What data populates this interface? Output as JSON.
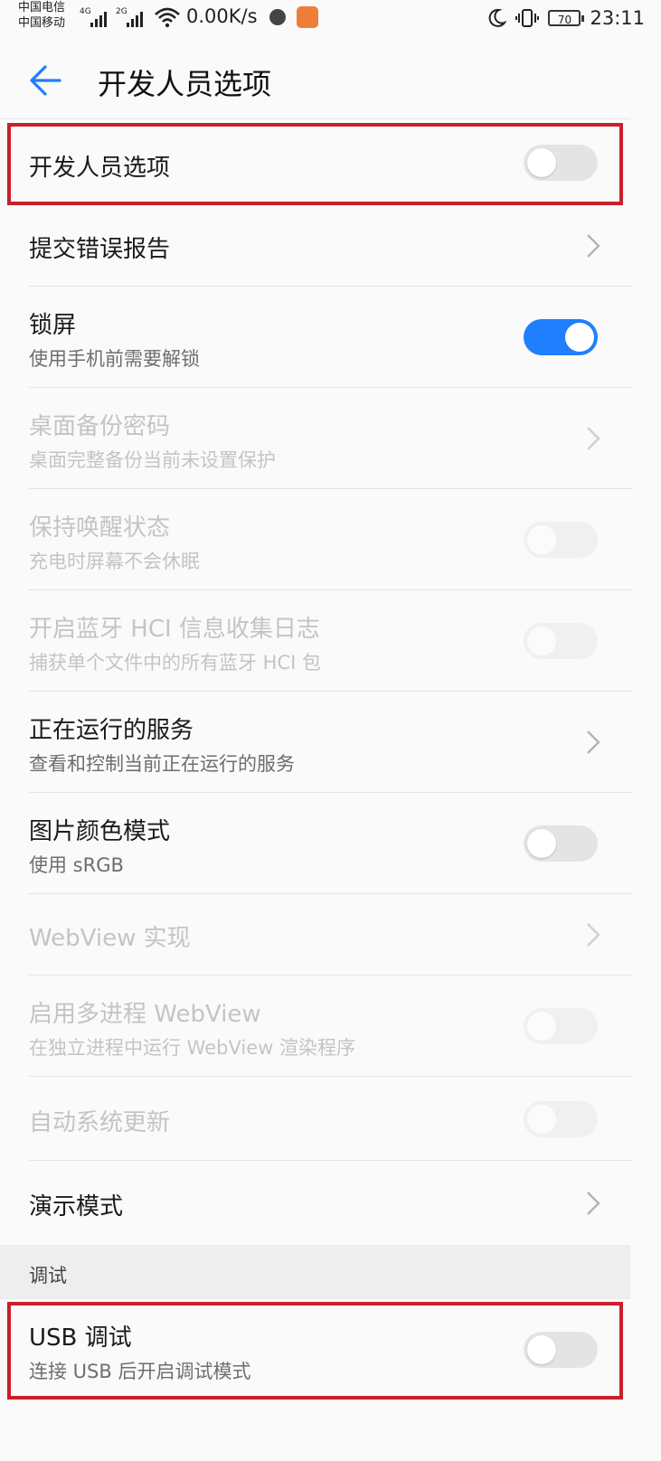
{
  "status_bar": {
    "carrier_1": "中国电信",
    "carrier_2": "中国移动",
    "net_1": "4G",
    "net_2": "2G",
    "speed": "0.00K/s",
    "battery": "70",
    "time": "23:11",
    "icons": [
      "wifi-icon",
      "app-notification-icon",
      "app-icon",
      "moon-icon",
      "vibrate-icon",
      "battery-icon"
    ]
  },
  "header": {
    "title": "开发人员选项",
    "back_icon": "arrow-left-icon"
  },
  "settings": [
    {
      "title": "开发人员选项",
      "control": "toggle",
      "on": false
    },
    {
      "title": "提交错误报告",
      "control": "chevron"
    },
    {
      "title": "锁屏",
      "subtitle": "使用手机前需要解锁",
      "control": "toggle",
      "on": true
    },
    {
      "title": "桌面备份密码",
      "subtitle": "桌面完整备份当前未设置保护",
      "control": "chevron",
      "disabled": true
    },
    {
      "title": "保持唤醒状态",
      "subtitle": "充电时屏幕不会休眠",
      "control": "toggle",
      "on": false,
      "disabled": true
    },
    {
      "title": "开启蓝牙 HCI 信息收集日志",
      "subtitle": "捕获单个文件中的所有蓝牙 HCI 包",
      "control": "toggle",
      "on": false,
      "disabled": true
    },
    {
      "title": "正在运行的服务",
      "subtitle": "查看和控制当前正在运行的服务",
      "control": "chevron"
    },
    {
      "title": "图片颜色模式",
      "subtitle": "使用 sRGB",
      "control": "toggle",
      "on": false
    },
    {
      "title": "WebView 实现",
      "control": "chevron",
      "disabled": true
    },
    {
      "title": "启用多进程 WebView",
      "subtitle": "在独立进程中运行 WebView 渲染程序",
      "control": "toggle",
      "on": false,
      "disabled": true
    },
    {
      "title": "自动系统更新",
      "control": "toggle",
      "on": false,
      "disabled": true
    },
    {
      "title": "演示模式",
      "control": "chevron"
    }
  ],
  "debug_section": {
    "label": "调试",
    "items": [
      {
        "title": "USB 调试",
        "subtitle": "连接 USB 后开启调试模式",
        "control": "toggle",
        "on": false
      }
    ]
  },
  "colors": {
    "accent": "#1f7fff",
    "highlight": "#c8202c"
  }
}
